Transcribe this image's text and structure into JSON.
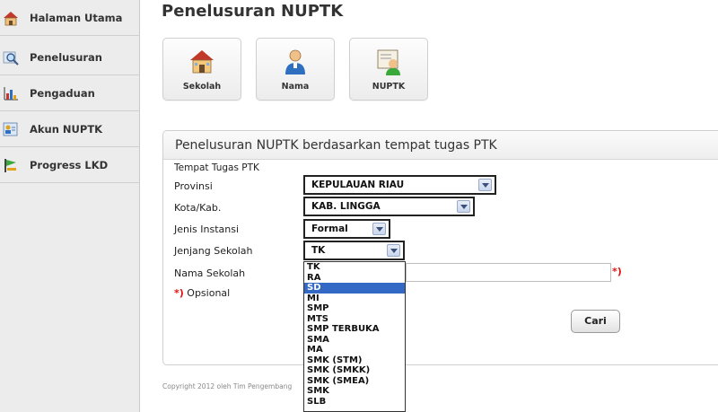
{
  "sidebar": {
    "items": [
      {
        "label": "Halaman Utama",
        "icon": "house-icon"
      },
      {
        "label": "Penelusuran",
        "icon": "magnifier-icon"
      },
      {
        "label": "Pengaduan",
        "icon": "chart-icon"
      },
      {
        "label": "Akun NUPTK",
        "icon": "id-card-icon"
      },
      {
        "label": "Progress LKD",
        "icon": "progress-flag-icon"
      }
    ]
  },
  "header": {
    "title": "Penelusuran NUPTK"
  },
  "tiles": [
    {
      "label": "Sekolah",
      "icon": "school-building-icon"
    },
    {
      "label": "Nama",
      "icon": "person-icon"
    },
    {
      "label": "NUPTK",
      "icon": "teacher-book-icon"
    }
  ],
  "form": {
    "title": "Penelusuran NUPTK berdasarkan tempat tugas PTK",
    "section_label": "Tempat Tugas PTK",
    "provinsi": {
      "label": "Provinsi",
      "value": "KEPULAUAN RIAU"
    },
    "kota": {
      "label": "Kota/Kab.",
      "value": "KAB. LINGGA"
    },
    "jenis_instansi": {
      "label": "Jenis Instansi",
      "value": "Formal"
    },
    "jenjang_sekolah": {
      "label": "Jenjang Sekolah",
      "value": "TK",
      "options": [
        "TK",
        "RA",
        "SD",
        "MI",
        "SMP",
        "MTS",
        "SMP TERBUKA",
        "SMA",
        "MA",
        "SMK (STM)",
        "SMK (SMKK)",
        "SMK (SMEA)",
        "SMK",
        "SLB"
      ],
      "highlighted_index": 2
    },
    "nama_sekolah": {
      "label": "Nama Sekolah",
      "value": "",
      "required_mark": "*)"
    },
    "optional_note": {
      "mark": "*)",
      "text": "Opsional"
    },
    "submit_label": "Cari"
  },
  "footer": {
    "text": "Copyright 2012 oleh Tim Pengembang"
  },
  "colors": {
    "sidebar_bg": "#ececec",
    "highlight": "#3368c4",
    "required": "#dd1111"
  }
}
